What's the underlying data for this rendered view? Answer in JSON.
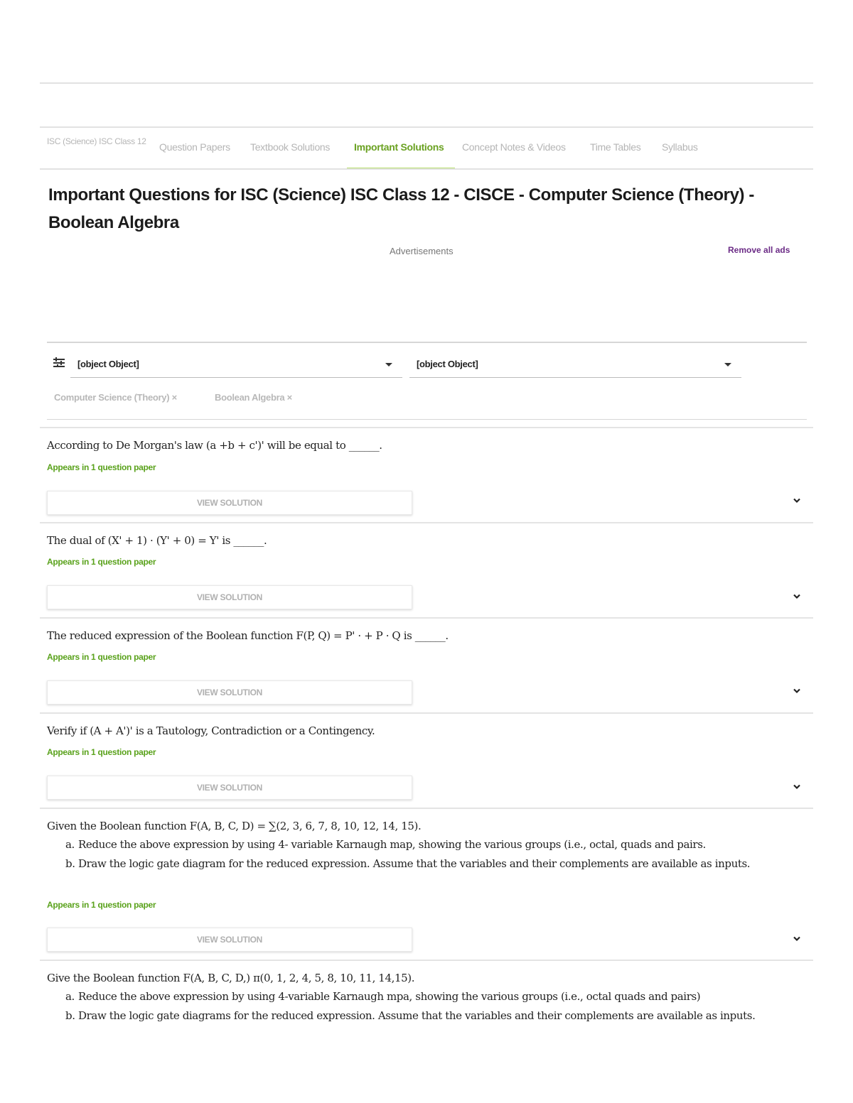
{
  "tabs": [
    {
      "label": "ISC (Science) ISC Class 12"
    },
    {
      "label": "Question Papers"
    },
    {
      "label": "Textbook Solutions"
    },
    {
      "label": "Important Solutions"
    },
    {
      "label": "Concept Notes & Videos"
    },
    {
      "label": "Time Tables"
    },
    {
      "label": "Syllabus"
    }
  ],
  "active_tab": "Important Solutions",
  "page_title": "Important Questions for ISC (Science) ISC Class 12 - CISCE - Computer Science (Theory) - Boolean Algebra",
  "ads": {
    "label": "Advertisements",
    "remove_label": "Remove all ads"
  },
  "filters": {
    "select1": "[object Object]",
    "select2": "[object Object]",
    "chips": [
      "Computer Science (Theory) ×",
      "Boolean Algebra ×"
    ]
  },
  "questions": [
    {
      "text": "According to De Morgan's law (a +b + c')' will be equal to ______.",
      "appears": "Appears in 1 question paper",
      "button": "VIEW SOLUTION"
    },
    {
      "text": "The dual of (X' + 1) · (Y' + 0) = Y' is ______.",
      "appears": "Appears in 1 question paper",
      "button": "VIEW SOLUTION"
    },
    {
      "text": "The reduced expression of the Boolean function F(P, Q) = P' · + P · Q is ______.",
      "appears": "Appears in 1 question paper",
      "button": "VIEW SOLUTION"
    },
    {
      "text": "Verify if (A + A')' is a Tautology, Contradiction or a Contingency.",
      "appears": "Appears in 1 question paper",
      "button": "VIEW SOLUTION"
    },
    {
      "text": "Given the Boolean function F(A, B, C, D) = ∑(2, 3, 6, 7, 8, 10, 12, 14, 15).",
      "items": [
        {
          "marker": "a.",
          "text": "Reduce the above expression by using 4- variable Karnaugh map, showing the various groups (i.e., octal, quads and pairs."
        },
        {
          "marker": "b.",
          "text": "Draw the logic gate diagram for the reduced expression. Assume that the variables and their complements are available as inputs."
        }
      ],
      "appears": "Appears in 1 question paper",
      "button": "VIEW SOLUTION"
    },
    {
      "text": "Give the Boolean function F(A, B, C, D,) π(0, 1, 2, 4, 5, 8, 10, 11, 14,15).",
      "items": [
        {
          "marker": "a.",
          "text": "Reduce the above expression by using 4-variable Karnaugh mpa, showing the various groups (i.e., octal quads and pairs)"
        },
        {
          "marker": "b.",
          "text": "Draw the logic gate diagrams for the reduced expression. Assume that the variables and their complements are available as inputs."
        }
      ]
    }
  ],
  "colors": {
    "accent": "#6aa121",
    "appears": "#5aa21c",
    "remove_ads": "#6b2b86"
  }
}
